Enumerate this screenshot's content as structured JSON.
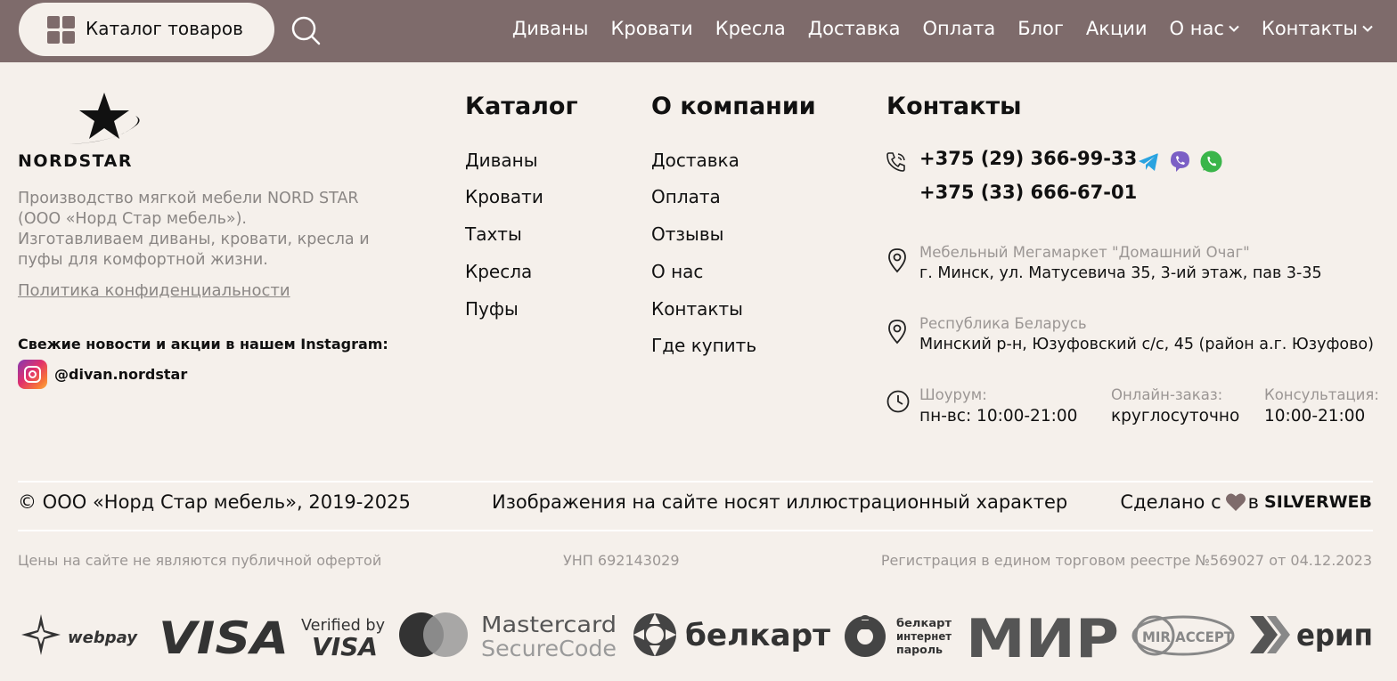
{
  "header": {
    "catalog_button": "Каталог товаров",
    "nav": [
      {
        "label": "Диваны",
        "dropdown": false
      },
      {
        "label": "Кровати",
        "dropdown": false
      },
      {
        "label": "Кресла",
        "dropdown": false
      },
      {
        "label": "Доставка",
        "dropdown": false
      },
      {
        "label": "Оплата",
        "dropdown": false
      },
      {
        "label": "Блог",
        "dropdown": false
      },
      {
        "label": "Акции",
        "dropdown": false
      },
      {
        "label": "О нас",
        "dropdown": true
      },
      {
        "label": "Контакты",
        "dropdown": true
      }
    ]
  },
  "brand": {
    "logo_text": "NORDSTAR",
    "about_lines": [
      "Производство мягкой мебели NORD STAR",
      "(ООО «Норд Стар мебель»).",
      "Изготавливаем диваны, кровати, кресла и",
      "пуфы для комфортной жизни."
    ],
    "privacy_link": "Политика конфиденциальности",
    "instagram_title": "Свежие новости и акции в нашем Instagram:",
    "instagram_handle": "@divan.nordstar"
  },
  "catalog": {
    "title": "Каталог",
    "links": [
      "Диваны",
      "Кровати",
      "Тахты",
      "Кресла",
      "Пуфы"
    ]
  },
  "company": {
    "title": "О компании",
    "links": [
      "Доставка",
      "Оплата",
      "Отзывы",
      "О нас",
      "Контакты",
      "Где купить"
    ]
  },
  "contacts": {
    "title": "Контакты",
    "phones": [
      "+375 (29) 366-99-33",
      "+375 (33) 666-67-01"
    ],
    "messengers": [
      "telegram-icon",
      "viber-icon",
      "whatsapp-icon"
    ],
    "addresses": [
      {
        "label": "Мебельный Мегамаркет \"Домашний Очаг\"",
        "value": "г. Минск, ул. Матусевича 35, 3-ий этаж, пав 3-35"
      },
      {
        "label": "Республика Беларусь",
        "value": "Минский р-н, Юзуфовский с/с, 45 (район а.г. Юзуфово)"
      }
    ],
    "hours": [
      {
        "label": "Шоурум:",
        "value": "пн-вс: 10:00-21:00"
      },
      {
        "label": "Онлайн-заказ:",
        "value": "круглосуточно"
      },
      {
        "label": "Консультация:",
        "value": "10:00-21:00"
      }
    ]
  },
  "footer": {
    "copyright": "© ООО «Норд Стар мебель», 2019-2025",
    "disclaimer": "Изображения на сайте носят иллюстрационный характер",
    "made_prefix": "Сделано с",
    "made_in": "в",
    "made_by": "SILVERWEB",
    "offer_note": "Цены на сайте не являются публичной офертой",
    "unp": "УНП 692143029",
    "registry": "Регистрация в едином торговом реестре №569027 от 04.12.2023"
  },
  "payments": {
    "webpay": "webpay",
    "visa": "VISA",
    "verified_by": "Verified by",
    "verified_visa": "VISA",
    "mastercard": "Mastercard",
    "securecode": "SecureCode",
    "belkart": "белкарт",
    "belkart_net": [
      "белкарт",
      "интернет",
      "пароль"
    ],
    "mir": "МИР",
    "mir_accept": "MIR ACCEPT",
    "erip": "ерип"
  },
  "colors": {
    "header_bg": "#7e6b6b",
    "page_bg": "#f5f0eb",
    "muted_text": "#8a8684",
    "logo_gray": "#3a3a3a"
  }
}
